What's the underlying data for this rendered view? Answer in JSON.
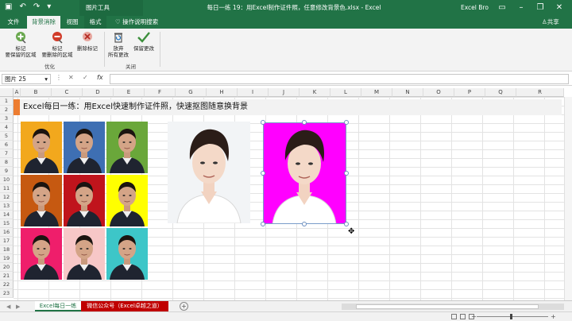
{
  "titlebar": {
    "context_tab": "图片工具",
    "document_title": "每日一练 19：用Excel制作证件照，任意修改背景色.xlsx  -  Excel",
    "user": "Excel Bro"
  },
  "tabs": [
    {
      "label": "文件"
    },
    {
      "label": "背景消除"
    },
    {
      "label": "视图"
    },
    {
      "label": "格式"
    }
  ],
  "tell_me": "操作说明搜索",
  "share": "共享",
  "ribbon": {
    "mark_keep_line1": "标记",
    "mark_keep_line2": "要保留的区域",
    "mark_remove_line1": "标记",
    "mark_remove_line2": "要删除的区域",
    "delete_mark": "删除标记",
    "discard_line1": "放弃",
    "discard_line2": "所有更改",
    "keep_changes": "保留更改",
    "group_refine": "优化",
    "group_close": "关闭"
  },
  "formula_bar": {
    "name_box": "图片 25",
    "cancel_glyph": "✕",
    "enter_glyph": "✓",
    "fx": "fx",
    "value": ""
  },
  "columns": [
    "A",
    "B",
    "C",
    "D",
    "E",
    "F",
    "G",
    "H",
    "I",
    "J",
    "K",
    "L",
    "M",
    "N",
    "O",
    "P",
    "Q",
    "R"
  ],
  "rows": [
    "1",
    "2",
    "3",
    "4",
    "5",
    "6",
    "7",
    "8",
    "9",
    "10",
    "11",
    "12",
    "13",
    "14",
    "15",
    "16",
    "17",
    "18",
    "19",
    "20",
    "21",
    "22",
    "23"
  ],
  "banner_text": "Excel每日一练：用Excel快速制作证件照，快速抠图随意换背景",
  "photo_grid_colors": [
    "#f2a81d",
    "#3e6fb3",
    "#6aa73a",
    "#c65911",
    "#c0141c",
    "#ffff00",
    "#ef1e6b",
    "#f7c7c7",
    "#3dc6c8"
  ],
  "original_photo_bg": "#f2f4f6",
  "edited_photo_bg": "#ff00ff",
  "sheets": [
    {
      "label": "Excel每日一练"
    },
    {
      "label": "微信公众号（Excel卓越之道）"
    }
  ],
  "colors": {
    "excel_green": "#217346",
    "banner_accent": "#ed7d31",
    "tab_red": "#c00000"
  }
}
